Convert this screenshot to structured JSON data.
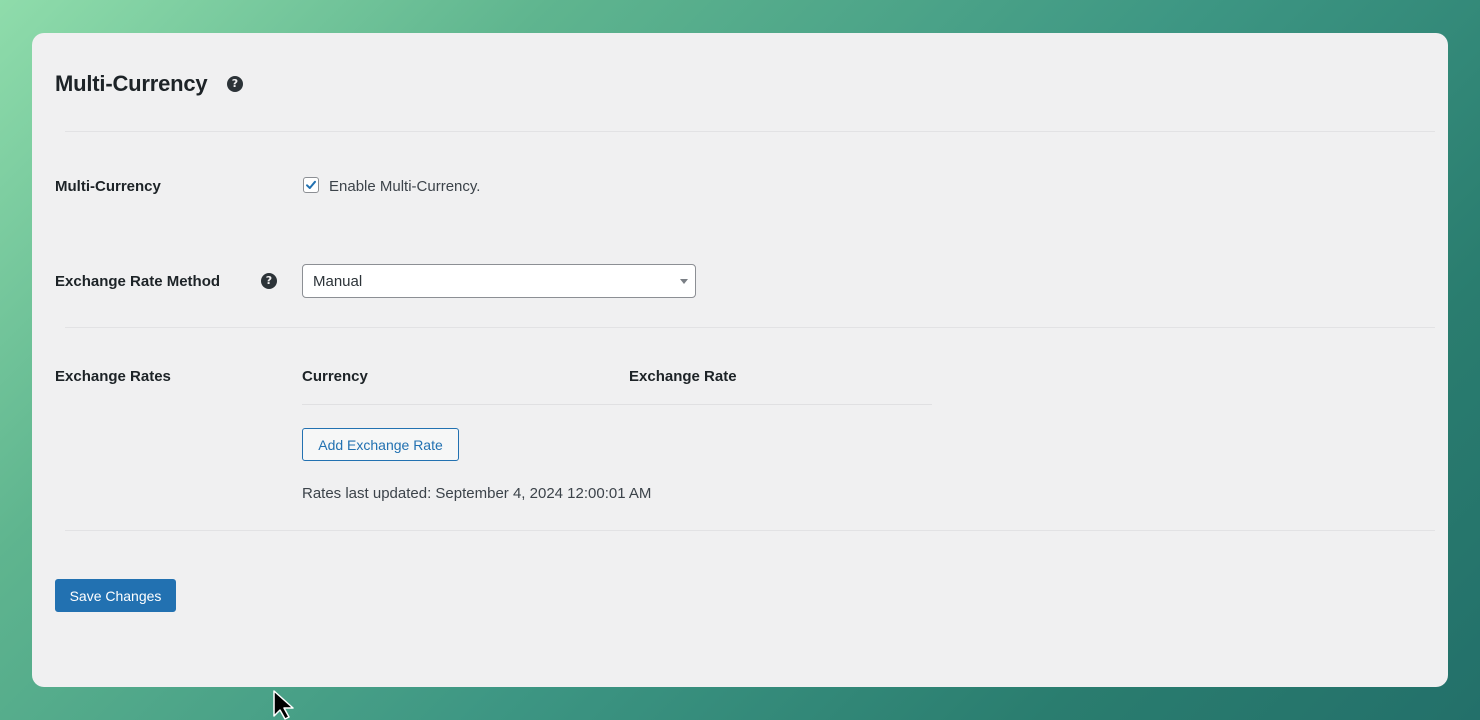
{
  "page": {
    "title": "Multi-Currency",
    "title_help_icon": "question-circle-icon"
  },
  "settings": {
    "multi_currency": {
      "label": "Multi-Currency",
      "checkbox_label": "Enable Multi-Currency.",
      "checked": true
    },
    "exchange_rate_method": {
      "label": "Exchange Rate Method",
      "help_icon": "question-circle-icon",
      "selected_value": "Manual"
    },
    "exchange_rates": {
      "label": "Exchange Rates",
      "columns": [
        "Currency",
        "Exchange Rate"
      ],
      "rows": [],
      "add_button_label": "Add Exchange Rate",
      "last_updated_text": "Rates last updated: September 4, 2024 12:00:01 AM"
    }
  },
  "actions": {
    "save_label": "Save Changes"
  },
  "colors": {
    "accent": "#2271b1",
    "panel_background": "#f0f0f1",
    "text": "#1d2327"
  }
}
